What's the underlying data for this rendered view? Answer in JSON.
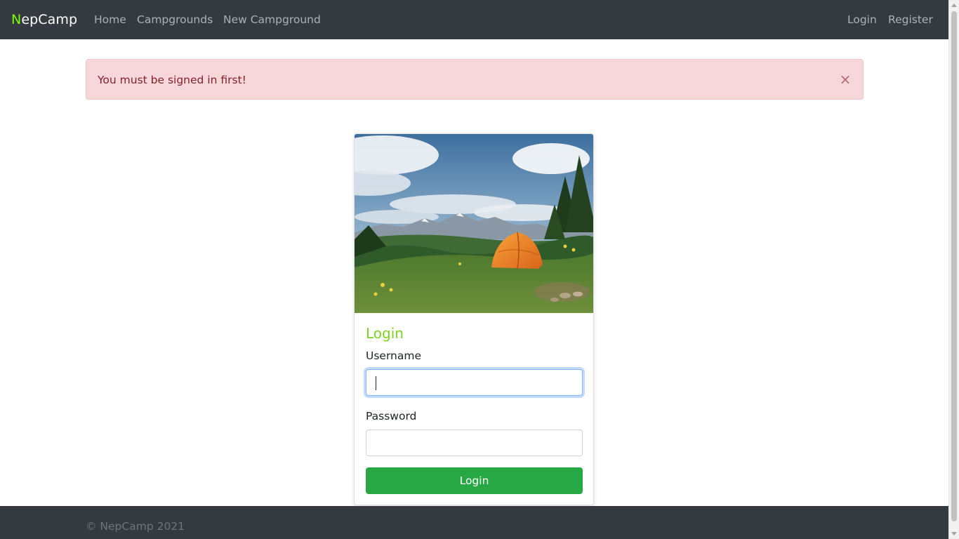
{
  "navbar": {
    "brand_first": "N",
    "brand_rest": "epCamp",
    "links": [
      "Home",
      "Campgrounds",
      "New Campground"
    ],
    "auth_links": [
      "Login",
      "Register"
    ]
  },
  "alert": {
    "message": "You must be signed in first!",
    "close_symbol": "×"
  },
  "card": {
    "image_icon": "campground-tent-photo",
    "title": "Login",
    "username_label": "Username",
    "username_value": "",
    "password_label": "Password",
    "password_value": "",
    "submit_label": "Login"
  },
  "footer": {
    "text": "© NepCamp 2021"
  },
  "colors": {
    "navbar_bg": "#343a40",
    "brand_accent": "#7cfc00",
    "alert_bg": "#f8d7da",
    "alert_text": "#842029",
    "title_green": "#7ed321",
    "button_green": "#28a745"
  }
}
